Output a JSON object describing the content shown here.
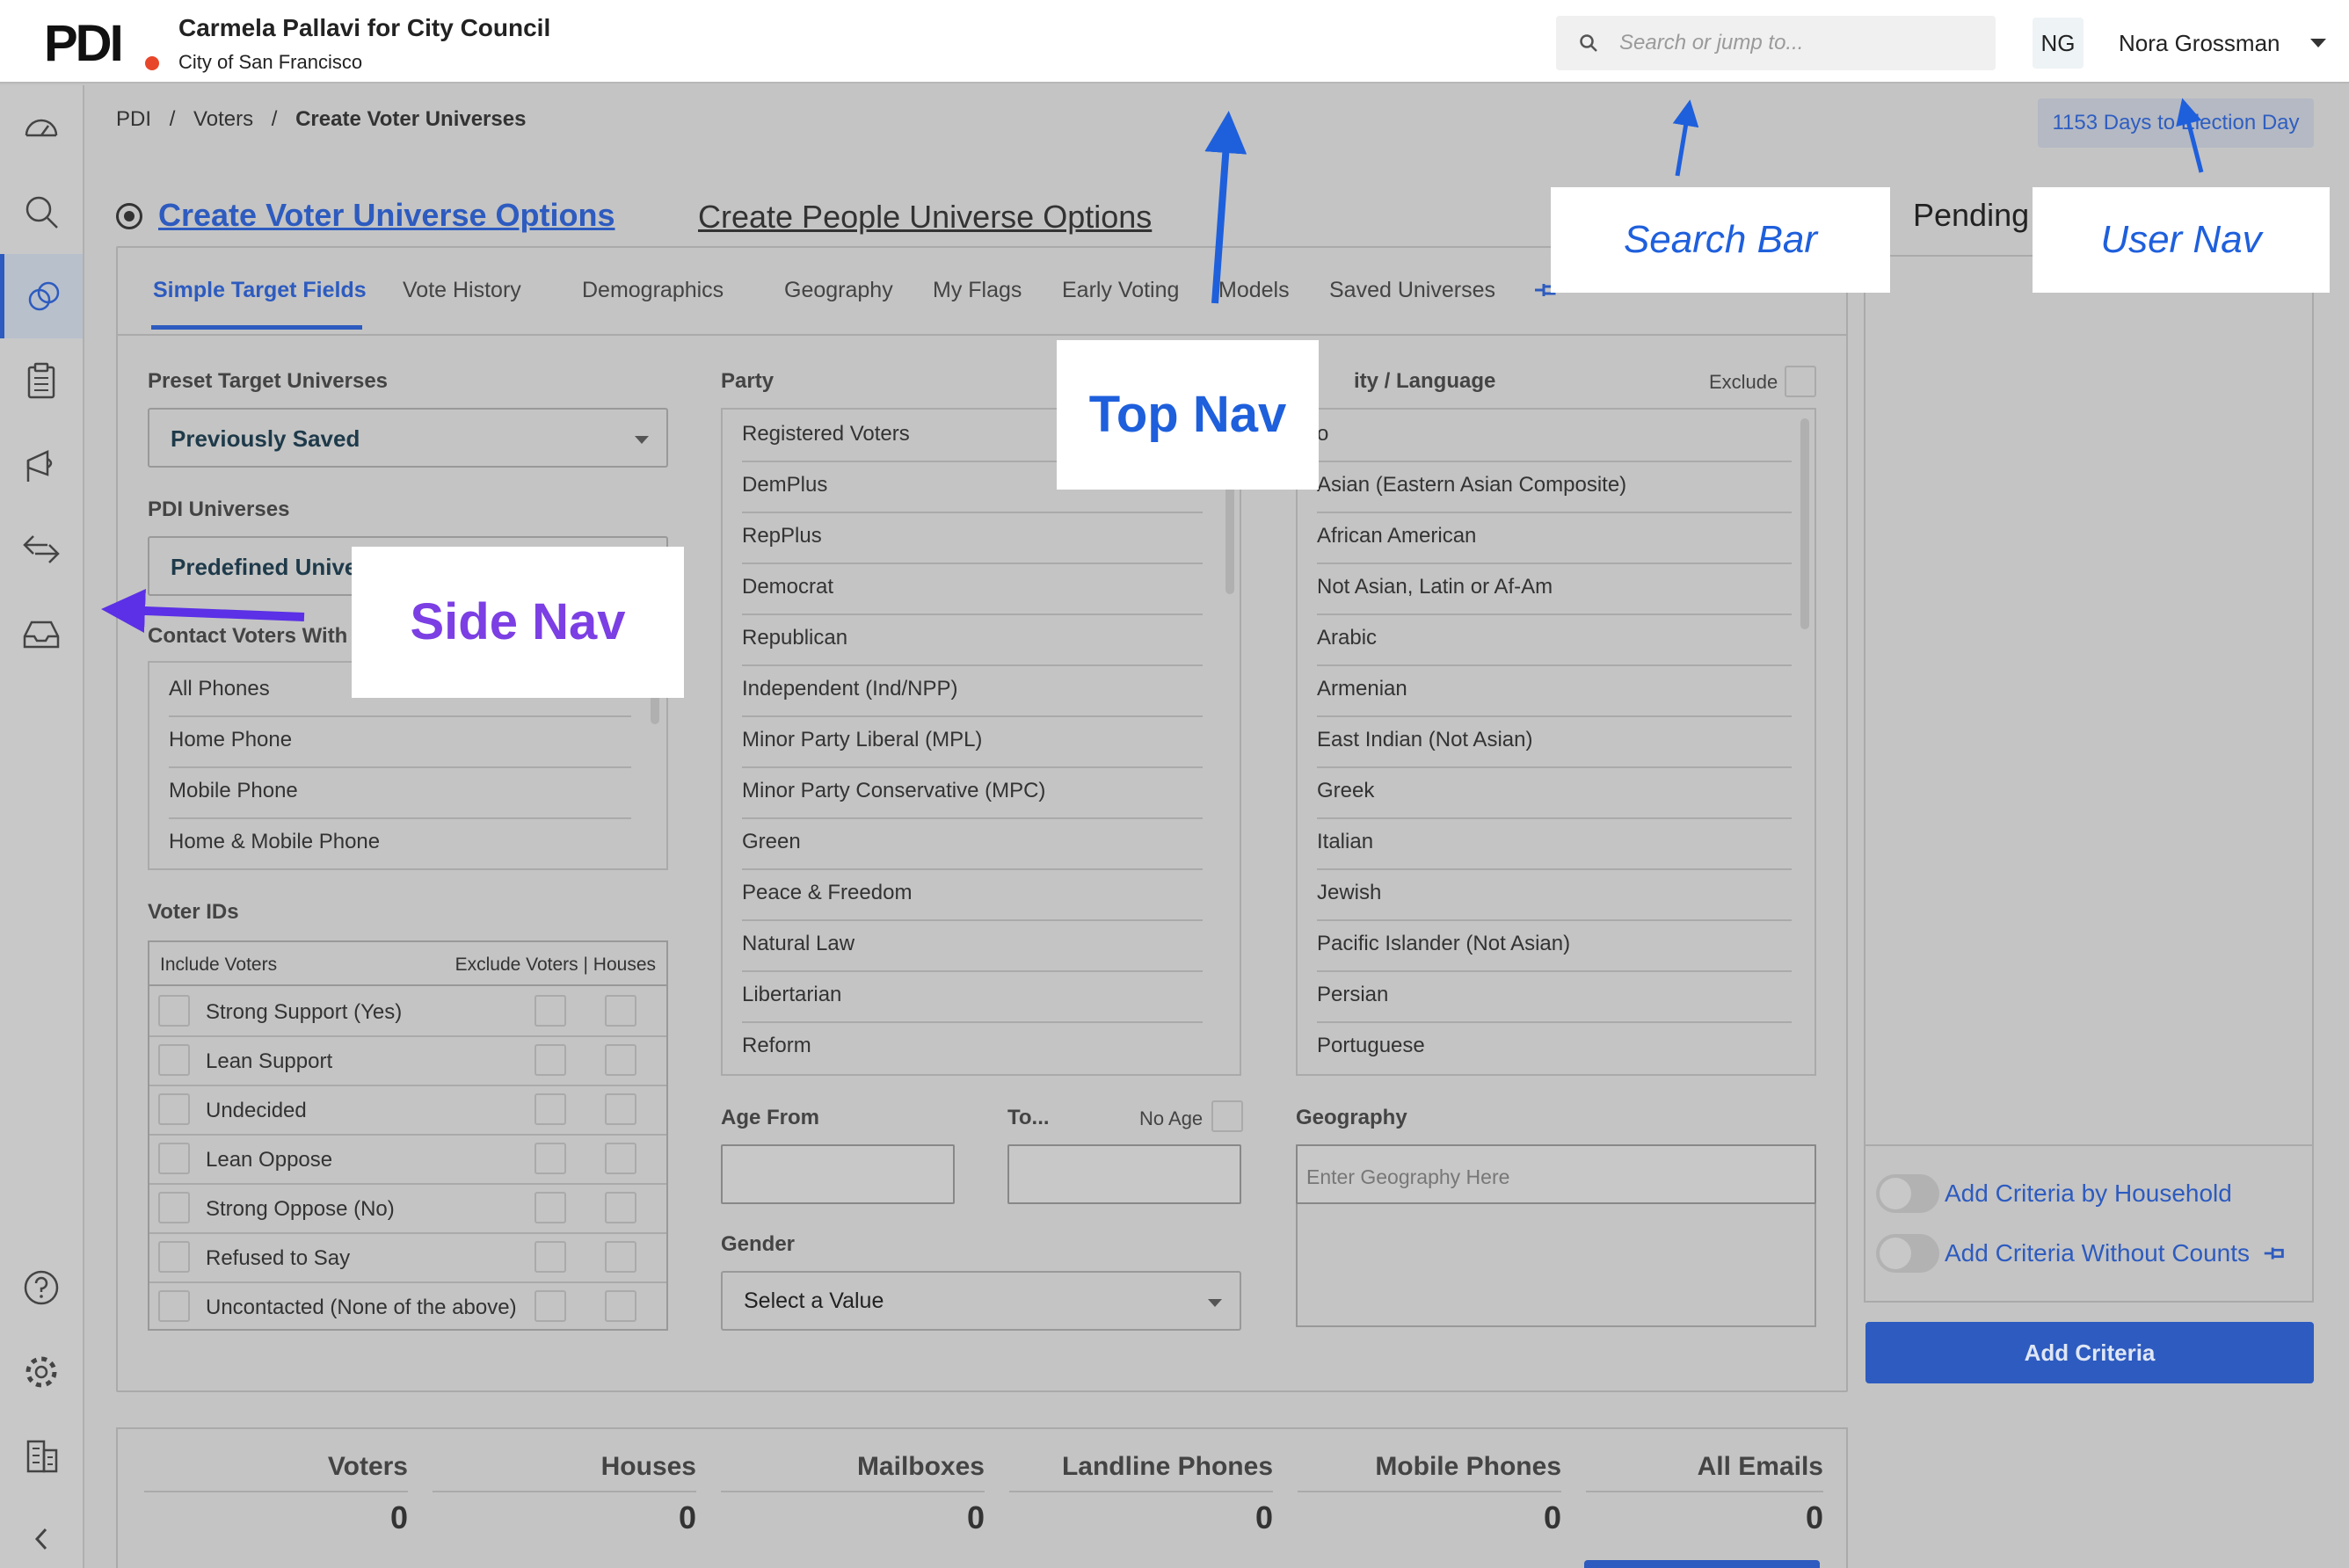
{
  "header": {
    "logo": "PDI",
    "campaign_name": "Carmela Pallavi for City Council",
    "campaign_city": "City of San Francisco",
    "search_placeholder": "Search or jump to...",
    "user_initials": "NG",
    "user_name": "Nora Grossman"
  },
  "sidenav": {
    "items": [
      {
        "icon": "dashboard-icon"
      },
      {
        "icon": "search-icon"
      },
      {
        "icon": "universes-icon",
        "active": true
      },
      {
        "icon": "clipboard-icon"
      },
      {
        "icon": "megaphone-icon"
      },
      {
        "icon": "transfer-icon"
      },
      {
        "icon": "inbox-icon"
      },
      {
        "icon": "help-icon"
      },
      {
        "icon": "settings-icon"
      },
      {
        "icon": "building-icon"
      },
      {
        "icon": "collapse-chevron-icon"
      }
    ]
  },
  "breadcrumb": {
    "items": [
      "PDI",
      "/",
      "Voters",
      "/",
      "Create Voter Universes"
    ]
  },
  "election_badge": "1153 Days to Election Day",
  "titles": {
    "voter_universe": "Create Voter Universe Options",
    "people_universe": "Create People Universe Options",
    "pending": "Pending"
  },
  "tabs": [
    "Simple Target Fields",
    "Vote History",
    "Demographics",
    "Geography",
    "My Flags",
    "Early Voting",
    "Models",
    "Saved Universes"
  ],
  "preset": {
    "label": "Preset Target Universes",
    "value": "Previously Saved"
  },
  "pdi_universes": {
    "label": "PDI Universes",
    "value": "Predefined Universes"
  },
  "contact": {
    "label": "Contact Voters With",
    "items": [
      "All Phones",
      "Home Phone",
      "Mobile Phone",
      "Home & Mobile Phone"
    ]
  },
  "voter_ids": {
    "label": "Voter IDs",
    "header_include": "Include Voters",
    "header_exclude": "Exclude Voters | Houses",
    "rows": [
      "Strong Support (Yes)",
      "Lean Support",
      "Undecided",
      "Lean Oppose",
      "Strong Oppose (No)",
      "Refused to Say",
      "Uncontacted (None of the above)"
    ]
  },
  "party": {
    "label": "Party",
    "items": [
      "Registered Voters",
      "DemPlus",
      "RepPlus",
      "Democrat",
      "Republican",
      "Independent (Ind/NPP)",
      "Minor Party Liberal (MPL)",
      "Minor Party Conservative (MPC)",
      "Green",
      "Peace & Freedom",
      "Natural Law",
      "Libertarian",
      "Reform"
    ]
  },
  "ethnicity": {
    "label": "ity / Language",
    "exclude": "Exclude",
    "items": [
      "o",
      "Asian (Eastern Asian Composite)",
      "African American",
      "Not Asian, Latin or Af-Am",
      "Arabic",
      "Armenian",
      "East Indian (Not Asian)",
      "Greek",
      "Italian",
      "Jewish",
      "Pacific Islander (Not Asian)",
      "Persian",
      "Portuguese"
    ]
  },
  "age": {
    "from_label": "Age From",
    "to_label": "To...",
    "no_age": "No Age"
  },
  "gender": {
    "label": "Gender",
    "value": "Select a Value"
  },
  "geography": {
    "label": "Geography",
    "placeholder": "Enter Geography Here"
  },
  "right_panel": {
    "toggle_household": "Add Criteria by Household",
    "toggle_without_counts": "Add Criteria Without Counts",
    "add_button": "Add Criteria"
  },
  "stats": [
    {
      "label": "Voters",
      "value": "0"
    },
    {
      "label": "Houses",
      "value": "0"
    },
    {
      "label": "Mailboxes",
      "value": "0"
    },
    {
      "label": "Landline Phones",
      "value": "0"
    },
    {
      "label": "Mobile Phones",
      "value": "0"
    },
    {
      "label": "All Emails",
      "value": "0"
    }
  ],
  "annotations": {
    "search_bar": "Search Bar",
    "user_nav": "User Nav",
    "top_nav": "Top Nav",
    "side_nav": "Side Nav"
  },
  "colors": {
    "accent": "#2d5bbf",
    "annotation": "#1e5fdc",
    "side_nav_annotation": "#7b3fe4",
    "overlay": "#c4c4c4"
  }
}
